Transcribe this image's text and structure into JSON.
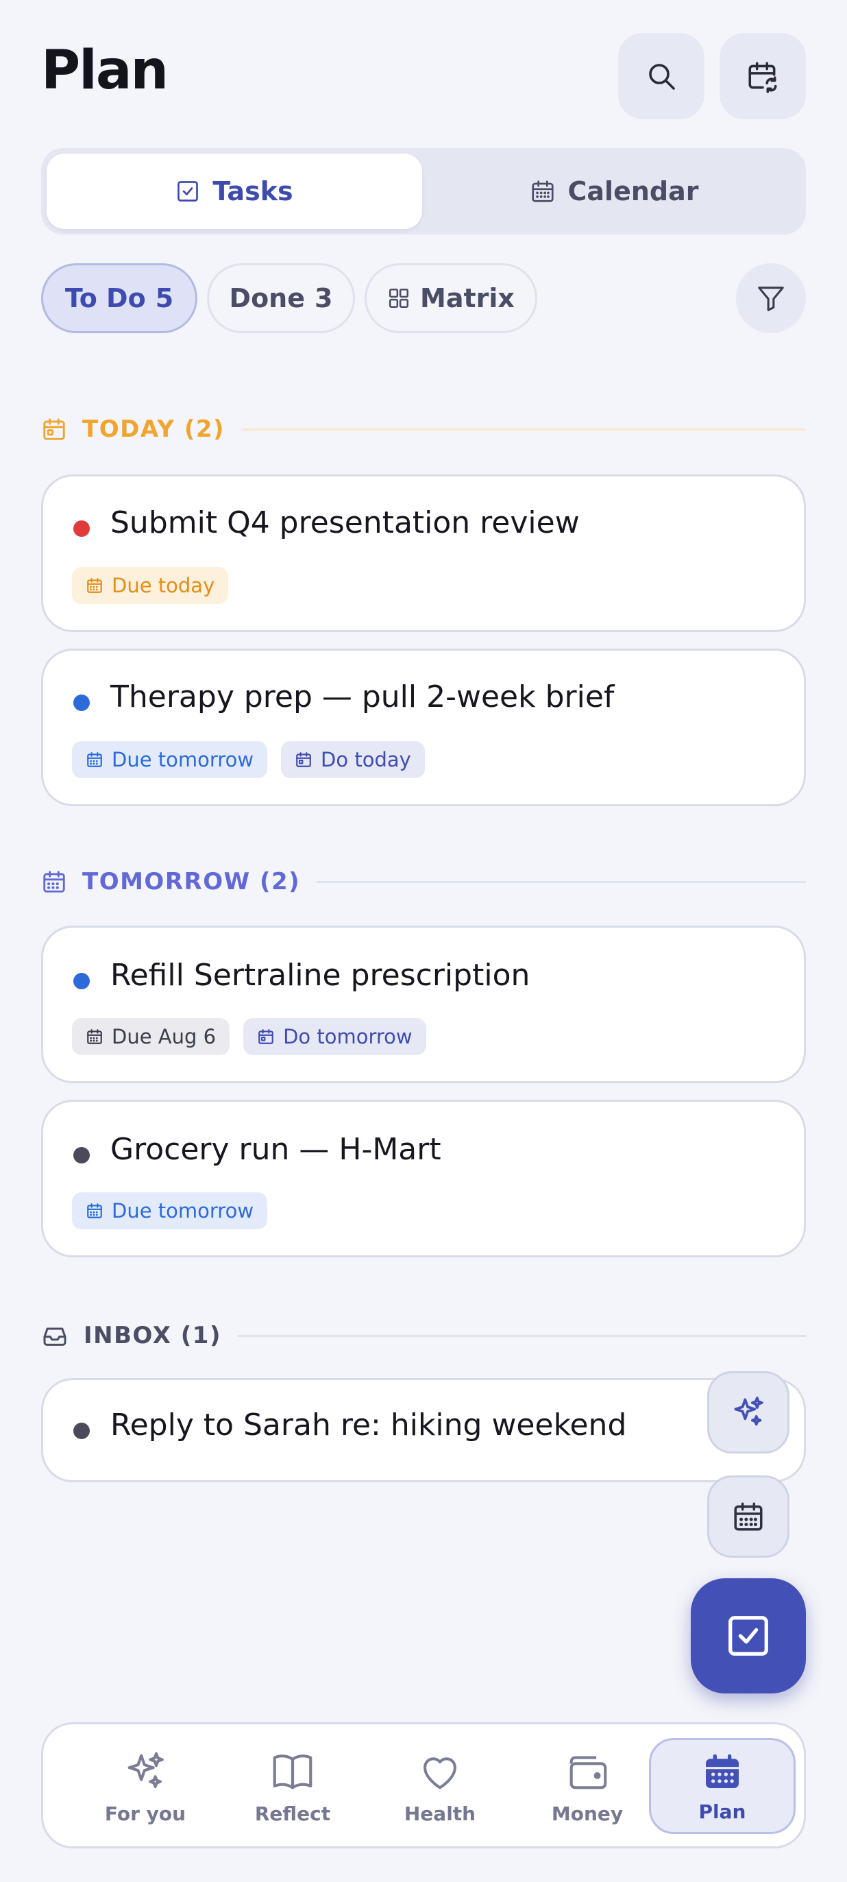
{
  "header": {
    "title": "Plan",
    "search_icon": "search-icon",
    "calendar_sync_icon": "calendar-sync-icon"
  },
  "view_tabs": [
    {
      "label": "Tasks",
      "icon": "checkbox-icon",
      "active": true
    },
    {
      "label": "Calendar",
      "icon": "calendar-icon",
      "active": false
    }
  ],
  "filters": {
    "todo": {
      "label": "To Do",
      "count": "5"
    },
    "done": {
      "label": "Done",
      "count": "3"
    },
    "matrix": {
      "label": "Matrix"
    }
  },
  "sections": {
    "today": {
      "label": "TODAY (2)",
      "color": "#f0a531"
    },
    "tomorrow": {
      "label": "TOMORROW (2)",
      "color": "#6269d6"
    },
    "inbox": {
      "label": "INBOX (1)",
      "color": "#4a4d63"
    }
  },
  "tasks": {
    "t1": {
      "title": "Submit Q4 presentation review",
      "dot_color": "#e03a3a",
      "tags": [
        {
          "label": "Due today",
          "style": "orange"
        }
      ]
    },
    "t2": {
      "title": "Therapy prep — pull 2-week brief",
      "dot_color": "#2d6ad9",
      "tags": [
        {
          "label": "Due tomorrow",
          "style": "blue"
        },
        {
          "label": "Do today",
          "style": "indigo"
        }
      ]
    },
    "t3": {
      "title": "Refill Sertraline prescription",
      "dot_color": "#2d6ad9",
      "tags": [
        {
          "label": "Due Aug 6",
          "style": "grey"
        },
        {
          "label": "Do tomorrow",
          "style": "indigo"
        }
      ]
    },
    "t4": {
      "title": "Grocery run — H-Mart",
      "dot_color": "#4a4a5a",
      "tags": [
        {
          "label": "Due tomorrow",
          "style": "blue"
        }
      ]
    },
    "t5": {
      "title": "Reply to Sarah re: hiking weekend",
      "dot_color": "#4a4a5a",
      "tags": []
    }
  },
  "nav": [
    {
      "label": "For you",
      "icon": "sparkles-icon",
      "active": false
    },
    {
      "label": "Reflect",
      "icon": "book-icon",
      "active": false
    },
    {
      "label": "Health",
      "icon": "heart-icon",
      "active": false
    },
    {
      "label": "Money",
      "icon": "wallet-icon",
      "active": false
    },
    {
      "label": "Plan",
      "icon": "calendar-icon",
      "active": true
    }
  ],
  "colors": {
    "accent": "#4350b6",
    "background": "#f4f5fa"
  }
}
